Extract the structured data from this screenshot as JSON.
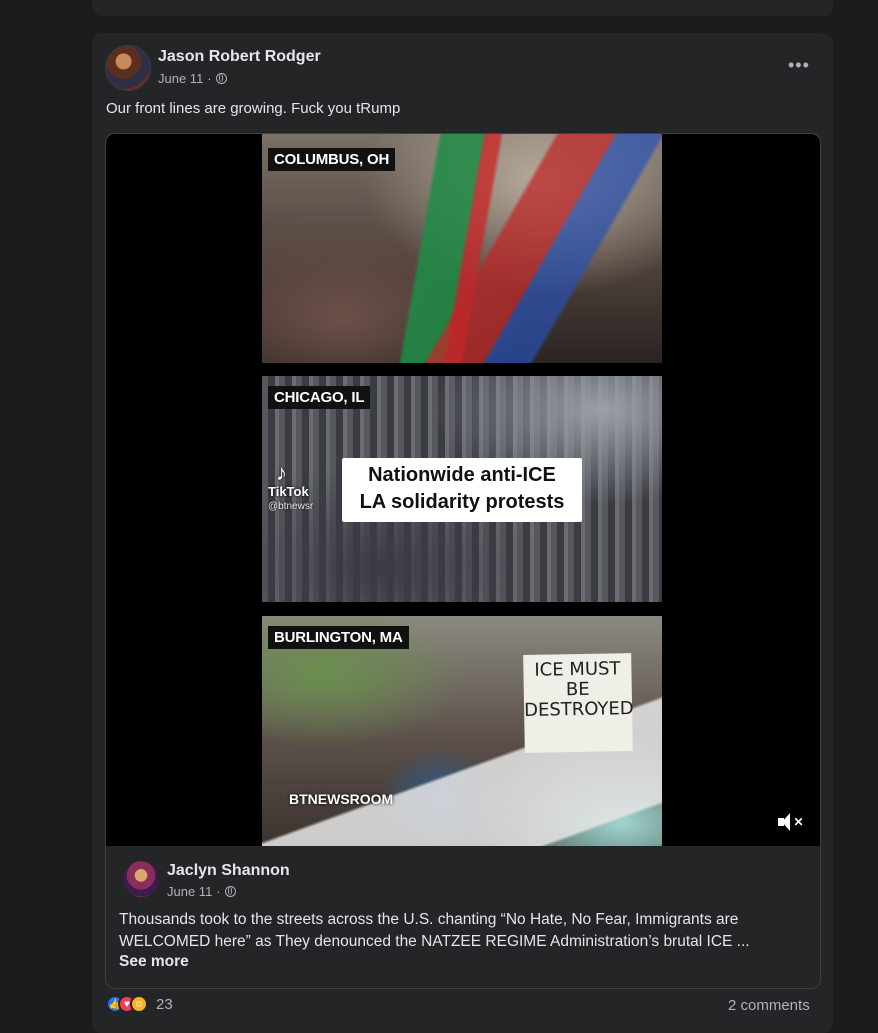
{
  "post": {
    "author": "Jason Robert Rodger",
    "date": "June 11",
    "audience_icon": "globe-icon",
    "more_icon": "more-options-icon",
    "more_label": "•••",
    "text": "Our front lines are growing. Fuck you tRump"
  },
  "video": {
    "panels": [
      {
        "location": "COLUMBUS, OH"
      },
      {
        "location": "CHICAGO, IL",
        "caption_line1": "Nationwide anti-ICE",
        "caption_line2": "LA solidarity protests"
      },
      {
        "location": "BURLINGTON, MA",
        "sign_text": "ICE MUST BE DESTROYED"
      }
    ],
    "tiktok_label": "TikTok",
    "tiktok_handle": "@btnewsr",
    "watermark": "BTNEWSROOM",
    "mute_icon": "muted-speaker-icon"
  },
  "shared_post": {
    "author": "Jaclyn Shannon",
    "date": "June 11",
    "audience_icon": "globe-icon",
    "text": "Thousands took to the streets across the U.S. chanting “No Hate, No Fear, Immigrants are WELCOMED here” as They denounced the NATZEE REGIME Administration’s brutal ICE ...",
    "see_more": "See more"
  },
  "footer": {
    "reaction_icons": [
      "like-icon",
      "love-icon",
      "care-icon"
    ],
    "reaction_count": "23",
    "comments": "2 comments"
  },
  "colors": {
    "background": "#1c1c1d",
    "card": "#242526",
    "text_primary": "#e4e6eb",
    "text_secondary": "#b0b3b8",
    "like_blue": "#1877f2",
    "love_red": "#f33e58"
  }
}
